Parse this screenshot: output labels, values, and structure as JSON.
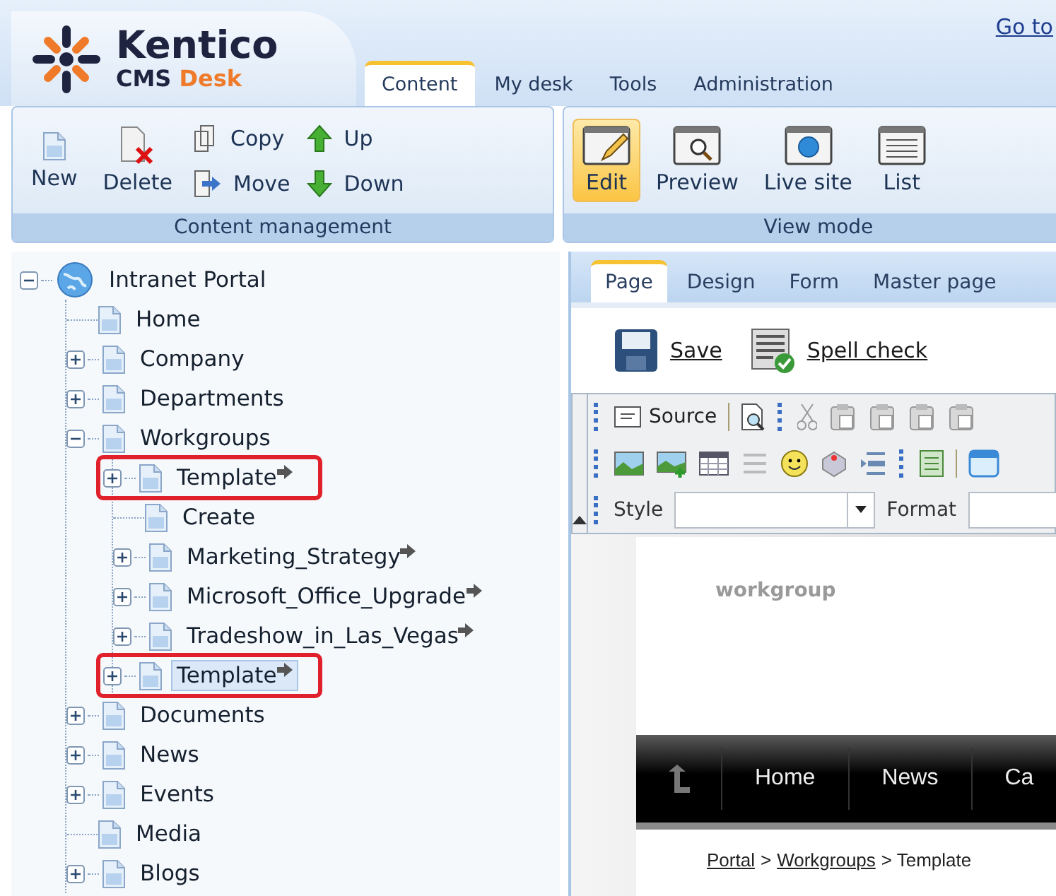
{
  "header": {
    "logo": {
      "name": "Kentico",
      "product": "CMS",
      "edition": "Desk"
    },
    "link": "Go to",
    "tabs": [
      {
        "label": "Content",
        "selected": true
      },
      {
        "label": "My desk",
        "selected": false
      },
      {
        "label": "Tools",
        "selected": false
      },
      {
        "label": "Administration",
        "selected": false
      }
    ]
  },
  "ribbon": {
    "content_management": {
      "title": "Content management",
      "new": "New",
      "delete": "Delete",
      "copy": "Copy",
      "move": "Move",
      "up": "Up",
      "down": "Down"
    },
    "view_mode": {
      "title": "View mode",
      "buttons": [
        {
          "label": "Edit",
          "selected": true
        },
        {
          "label": "Preview",
          "selected": false
        },
        {
          "label": "Live site",
          "selected": false
        },
        {
          "label": "List",
          "selected": false
        }
      ]
    }
  },
  "tree": {
    "label": "Intranet Portal",
    "kind": "expandable",
    "expanded": true,
    "children": [
      {
        "label": "Home",
        "kind": "leaf"
      },
      {
        "label": "Company",
        "kind": "expandable",
        "expanded": false
      },
      {
        "label": "Departments",
        "kind": "expandable",
        "expanded": false
      },
      {
        "label": "Workgroups",
        "kind": "expandable",
        "expanded": true,
        "children": [
          {
            "label": "Template",
            "kind": "expandable",
            "expanded": false,
            "linked": true,
            "highlighted": true,
            "selected": false
          },
          {
            "label": "Create",
            "kind": "leaf"
          },
          {
            "label": "Marketing_Strategy",
            "kind": "expandable",
            "expanded": false,
            "linked": true
          },
          {
            "label": "Microsoft_Office_Upgrade",
            "kind": "expandable",
            "expanded": false,
            "linked": true
          },
          {
            "label": "Tradeshow_in_Las_Vegas",
            "kind": "expandable",
            "expanded": false,
            "linked": true
          },
          {
            "label": "Template",
            "kind": "expandable",
            "expanded": false,
            "linked": true,
            "highlighted": true,
            "selected": true
          }
        ]
      },
      {
        "label": "Documents",
        "kind": "expandable",
        "expanded": false
      },
      {
        "label": "News",
        "kind": "expandable",
        "expanded": false
      },
      {
        "label": "Events",
        "kind": "expandable",
        "expanded": false
      },
      {
        "label": "Media",
        "kind": "leaf"
      },
      {
        "label": "Blogs",
        "kind": "expandable",
        "expanded": false
      }
    ]
  },
  "editor": {
    "tabs": [
      {
        "label": "Page",
        "selected": true
      },
      {
        "label": "Design",
        "selected": false
      },
      {
        "label": "Form",
        "selected": false
      },
      {
        "label": "Master page",
        "selected": false
      }
    ],
    "actions": [
      "Save",
      "Spell check"
    ],
    "toolbar": {
      "source": "Source",
      "style_label": "Style",
      "format_label": "Format"
    },
    "page": {
      "heading": "workgroup",
      "nav": [
        "Home",
        "News",
        "Ca"
      ],
      "breadcrumb": [
        {
          "label": "Portal",
          "link": true
        },
        {
          "label": ">",
          "link": false
        },
        {
          "label": "Workgroups",
          "link": true
        },
        {
          "label": "> Template",
          "link": false
        }
      ]
    }
  }
}
